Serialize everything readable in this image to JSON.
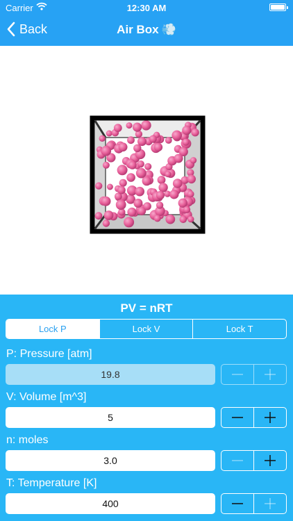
{
  "status_bar": {
    "carrier": "Carrier",
    "time": "12:30 AM"
  },
  "nav": {
    "back_label": "Back",
    "title": "Air Box",
    "title_icon": "💨"
  },
  "colors": {
    "accent": "#27a2f4",
    "panel": "#29b6f6",
    "particle": "#e8609a"
  },
  "panel": {
    "equation": "PV = nRT",
    "lock_options": [
      "Lock P",
      "Lock V",
      "Lock T"
    ],
    "lock_selected": "Lock P",
    "fields": [
      {
        "label": "P: Pressure [atm]",
        "value": "19.8"
      },
      {
        "label": "V: Volume [m^3]",
        "value": "5"
      },
      {
        "label": "n: moles",
        "value": "3.0"
      },
      {
        "label": "T: Temperature [K]",
        "value": "400"
      }
    ]
  }
}
